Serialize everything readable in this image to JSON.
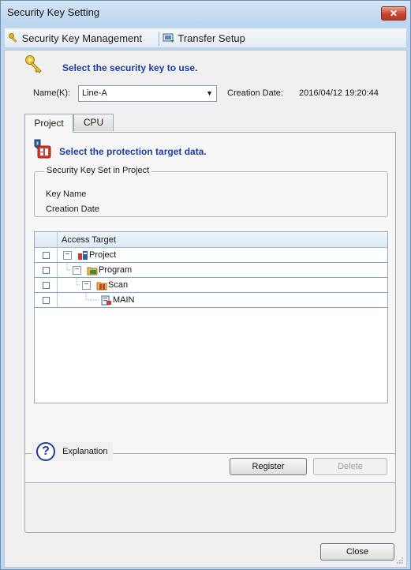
{
  "window": {
    "title": "Security Key Setting",
    "close_glyph": "✕"
  },
  "toolbar": {
    "items": [
      "Security Key Management",
      "Transfer Setup"
    ]
  },
  "key_section": {
    "heading": "Select the security key to use.",
    "name_label": "Name(K):",
    "name_value": "Line-A",
    "creation_date_label": "Creation Date:",
    "creation_date_value": "2016/04/12 19:20:44"
  },
  "tabs": [
    {
      "label": "Project",
      "active": true
    },
    {
      "label": "CPU",
      "active": false
    }
  ],
  "project_tab": {
    "heading": "Select the protection target data.",
    "group_title": "Security Key Set in Project",
    "key_name_label": "Key Name",
    "creation_date_label": "Creation Date",
    "grid_header": "Access Target",
    "nodes": [
      {
        "label": "Project",
        "expander": "−",
        "checked": false
      },
      {
        "label": "Program",
        "expander": "−",
        "checked": false
      },
      {
        "label": "Scan",
        "expander": "−",
        "checked": false
      },
      {
        "label": "MAIN",
        "expander": "",
        "checked": false
      }
    ],
    "register_button": "Register",
    "delete_button": "Delete"
  },
  "explanation": {
    "label": "Explanation",
    "icon_glyph": "?"
  },
  "footer": {
    "close_button": "Close"
  },
  "colors": {
    "accent": "#1e3c9e",
    "title_bar": "#bcd7ef",
    "close_button": "#c8432c"
  }
}
